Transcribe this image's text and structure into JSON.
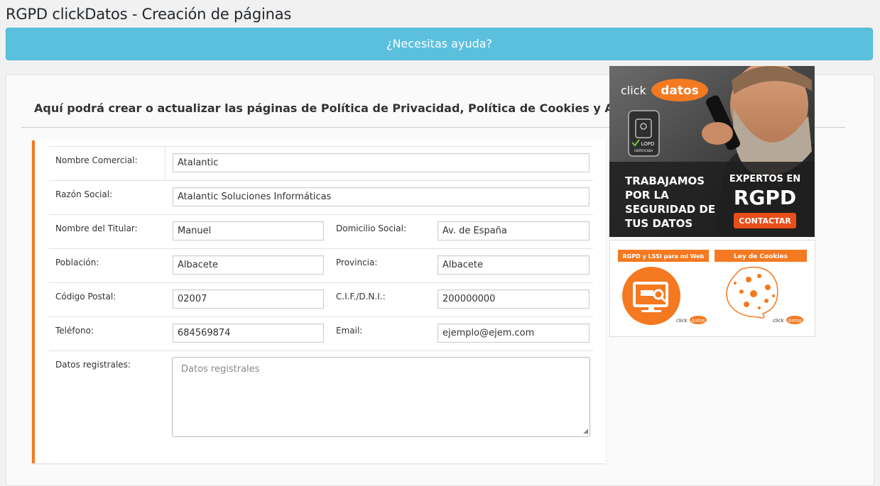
{
  "header": {
    "title": "RGPD clickDatos - Creación de páginas",
    "help_label": "¿Necesitas ayuda?"
  },
  "intro_text": "Aquí podrá crear o actualizar las páginas de Política de Privacidad, Política de Cookies y Avisos Legales.",
  "form": {
    "nombre_comercial": {
      "label": "Nombre Comercial:",
      "value": "Atalantic"
    },
    "razon_social": {
      "label": "Razón Social:",
      "value": "Atalantic Soluciones Informáticas"
    },
    "nombre_titular": {
      "label": "Nombre del Titular:",
      "value": "Manuel"
    },
    "domicilio_social": {
      "label": "Domicilio Social:",
      "value": "Av. de España"
    },
    "poblacion": {
      "label": "Población:",
      "value": "Albacete"
    },
    "provincia": {
      "label": "Provincia:",
      "value": "Albacete"
    },
    "codigo_postal": {
      "label": "Código Postal:",
      "value": "02007"
    },
    "cif": {
      "label": "C.I.F./D.N.I.:",
      "value": "200000000"
    },
    "telefono": {
      "label": "Teléfono:",
      "value": "684569874"
    },
    "email": {
      "label": "Email:",
      "value": "ejemplo@ejem.com"
    },
    "datos_registrales": {
      "label": "Datos registrales:",
      "value": "",
      "placeholder": "Datos registrales"
    }
  },
  "ad_top": {
    "brand_click": "click",
    "brand_datos": "datos",
    "seal_line1": "LOPD",
    "seal_line2": "CERTIFICADA",
    "headline": [
      "TRABAJAMOS",
      "POR LA",
      "SEGURIDAD DE",
      "TUS DATOS"
    ],
    "expertos": "EXPERTOS EN",
    "rgpd": "RGPD",
    "cta": "CONTACTAR"
  },
  "ad_bottom": {
    "left_label": "RGPD y LSSI para mi Web",
    "right_label": "Ley de Cookies",
    "mini_brand_click": "click",
    "mini_brand_datos": "datos"
  },
  "colors": {
    "accent_orange": "#f47920",
    "help_blue": "#5bc0de"
  }
}
